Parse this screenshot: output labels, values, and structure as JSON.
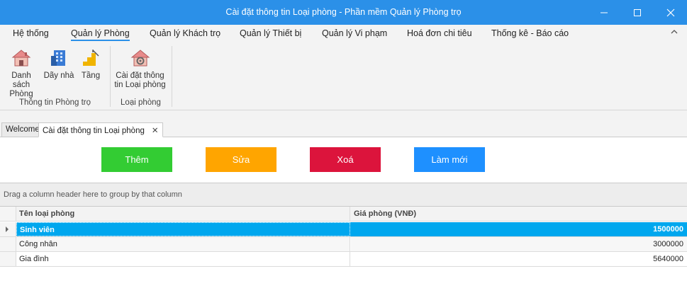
{
  "window": {
    "title": "Cài đặt thông tin Loại phòng - Phần mềm Quản lý Phòng trọ"
  },
  "menu": {
    "items": [
      {
        "label": "Hệ thống"
      },
      {
        "label": "Quản lý Phòng"
      },
      {
        "label": "Quản lý Khách trọ"
      },
      {
        "label": "Quản lý Thiết bị"
      },
      {
        "label": "Quản lý Vi phạm"
      },
      {
        "label": "Hoá đơn chi tiêu"
      },
      {
        "label": "Thống kê - Báo cáo"
      }
    ],
    "active": "Quản lý Phòng"
  },
  "ribbon": {
    "groups": [
      {
        "label": "Thông tin Phòng trọ"
      },
      {
        "label": "Loại phòng"
      }
    ],
    "buttons": [
      {
        "label": "Danh sách Phòng",
        "icon": "house-icon"
      },
      {
        "label": "Dãy nhà",
        "icon": "building-icon"
      },
      {
        "label": "Tầng",
        "icon": "stairs-icon"
      },
      {
        "label": "Cài đặt thông tin Loại phòng",
        "icon": "house-gear-icon"
      }
    ]
  },
  "tabs": [
    {
      "label": "Welcome"
    },
    {
      "label": "Cài đặt thông tin Loại phòng"
    }
  ],
  "actions": {
    "add": "Thêm",
    "edit": "Sửa",
    "delete": "Xoá",
    "refresh": "Làm mới",
    "colors": {
      "add": "#33cc33",
      "edit": "#ffa500",
      "delete": "#dc143c",
      "refresh": "#1e90ff"
    }
  },
  "grid": {
    "group_hint": "Drag a column header here to group by that column",
    "columns": [
      "Tên loại phòng",
      "Giá phòng (VNĐ)"
    ],
    "rows": [
      {
        "name": "Sinh viên",
        "price": "1500000"
      },
      {
        "name": "Công nhân",
        "price": "3000000"
      },
      {
        "name": "Gia đình",
        "price": "5640000"
      }
    ]
  },
  "colors": {
    "accent": "#2b90e8",
    "selection": "#00a7ee"
  }
}
